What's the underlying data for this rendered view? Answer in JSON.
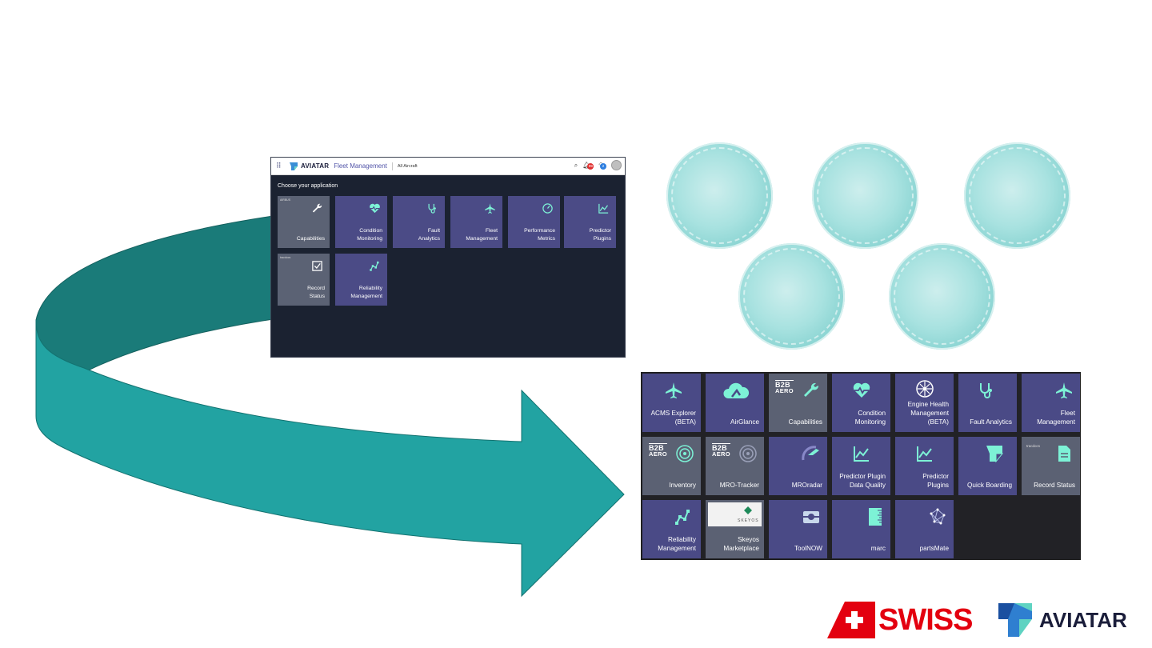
{
  "small_screenshot": {
    "brand": "AVIATAR",
    "app_name": "Fleet Management",
    "scope": "All Aircraft",
    "notification_count": "99",
    "help_count": "2",
    "heading": "Choose your application",
    "tiles": [
      {
        "label": "Capabilities",
        "icon": "wrench-icon",
        "mini": "AIRBUS",
        "style": "grey"
      },
      {
        "label": "Condition Monitoring",
        "icon": "heartbeat-icon",
        "style": "purple"
      },
      {
        "label": "Fault Analytics",
        "icon": "stethoscope-icon",
        "style": "purple"
      },
      {
        "label": "Fleet Management",
        "icon": "airplane-icon",
        "style": "purple"
      },
      {
        "label": "Performance Metrics",
        "icon": "gauge-icon",
        "style": "purple"
      },
      {
        "label": "Predictor Plugins",
        "icon": "line-chart-icon",
        "style": "purple"
      },
      {
        "label": "Record Status",
        "icon": "checkbox-icon",
        "mini": "tracdocs",
        "style": "grey"
      },
      {
        "label": "Reliability Management",
        "icon": "nodes-chart-icon",
        "style": "purple"
      }
    ]
  },
  "big_grid": {
    "tiles": [
      {
        "label": "ACMS Explorer (BETA)",
        "icon": "airplane-icon"
      },
      {
        "label": "AirGlance",
        "icon": "cloud-icon"
      },
      {
        "label": "Capabilities",
        "icon": "wrench-icon",
        "b2b": true
      },
      {
        "label": "Condition Monitoring",
        "icon": "heartbeat-icon"
      },
      {
        "label": "Engine Health Management (BETA)",
        "icon": "engine-fan-icon"
      },
      {
        "label": "Fault Analytics",
        "icon": "stethoscope-icon"
      },
      {
        "label": "Fleet Management",
        "icon": "airplane-icon"
      },
      {
        "label": "Inventory",
        "icon": "radar-icon",
        "b2b": true
      },
      {
        "label": "MRO-Tracker",
        "icon": "radar-icon",
        "b2b": true
      },
      {
        "label": "MROradar",
        "icon": "radar-plane-icon"
      },
      {
        "label": "Predictor Plugin Data Quality",
        "icon": "line-chart-icon"
      },
      {
        "label": "Predictor Plugins",
        "icon": "line-chart-icon"
      },
      {
        "label": "Quick Boarding",
        "icon": "aviatar-logo-icon"
      },
      {
        "label": "Record Status",
        "icon": "document-icon",
        "mini": "tracdocs"
      },
      {
        "label": "Reliability Management",
        "icon": "nodes-chart-icon"
      },
      {
        "label": "Skeyos Marketplace",
        "icon": "skeyos-logo-icon",
        "mini": "SKEYOS"
      },
      {
        "label": "ToolNOW",
        "icon": "toolbox-icon"
      },
      {
        "label": "marc",
        "icon": "ruler-icon"
      },
      {
        "label": "partsMate",
        "icon": "network-icon"
      }
    ],
    "b2b_top": "B2B",
    "b2b_bottom": "AERO"
  },
  "logos": {
    "swiss": "SWISS",
    "aviatar": "AVIATAR"
  },
  "colors": {
    "arrow_fill": "#22a3a2",
    "arrow_dark": "#1a7b79",
    "tile_purple": "#4a4a86",
    "tile_grey": "#5b6173",
    "icon_accent": "#7df2d6",
    "swiss_red": "#e3000f",
    "aviatar_navy": "#1a1d3a"
  }
}
